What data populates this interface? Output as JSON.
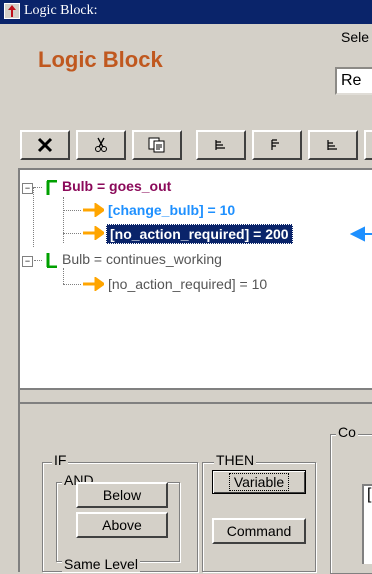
{
  "window": {
    "title": "Logic Block:"
  },
  "header": {
    "title": "Logic Block",
    "select_label": "Sele",
    "select_value": "Re"
  },
  "toolbar": {
    "icons": [
      "delete-x-icon",
      "cut-scissors-icon",
      "copy-icon",
      "align-left-icon",
      "align-top-icon",
      "align-right-icon"
    ]
  },
  "tree": {
    "nodes": [
      {
        "label": "Bulb = goes_out",
        "color": "#8b0a5a",
        "bold": true
      },
      {
        "label": "[change_bulb] = 10",
        "color": "#1e90ff",
        "bold": true
      },
      {
        "label": "[no_action_required] = 200",
        "color": "#ffffff",
        "bold": true,
        "selected": true
      },
      {
        "label": "Bulb = continues_working",
        "color": "#555555",
        "bold": false
      },
      {
        "label": "[no_action_required] = 10",
        "color": "#555555",
        "bold": false
      }
    ],
    "colors": {
      "if_bracket": "#00a000",
      "arrow": "#ffa500",
      "selection": "#0a246a",
      "pointer": "#1e90ff"
    }
  },
  "if_group": {
    "label": "IF",
    "and_label": "AND",
    "below": "Below",
    "above": "Above",
    "cut_label": "Same Level"
  },
  "then_group": {
    "label": "THEN",
    "variable": "Variable",
    "command": "Command"
  },
  "co_group": {
    "label": "Co",
    "field_value": "["
  }
}
